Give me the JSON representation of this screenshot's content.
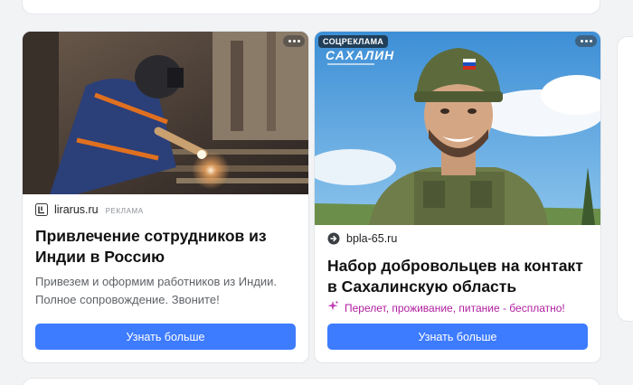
{
  "ads": [
    {
      "image_alt": "Welder working in a factory",
      "source_domain": "lirarus.ru",
      "ad_marker": "РЕКЛАМА",
      "title": "Привлечение сотрудников из Индии в Россию",
      "description": "Привезем и оформим работников из Индии. Полное сопровождение. Звоните!",
      "cta_label": "Узнать больше",
      "favicon_icon": "lirarus-logo-icon"
    },
    {
      "image_alt": "Illustrated smiling soldier in camouflage helmet",
      "image_label": "СОЦРЕКЛАМА",
      "image_brand": "САХАЛИН",
      "source_domain": "bpla-65.ru",
      "title": "Набор добровольцев на контакт в Сахалинскую область",
      "promo": "Перелет, проживание, питание - бесплатно!",
      "cta_label": "Узнать больше",
      "favicon_icon": "arrow-circle-icon",
      "promo_icon": "sparkle-icon"
    }
  ],
  "colors": {
    "cta_background": "#3d7bff",
    "promo_text": "#b01fa0",
    "page_background": "#f2f3f5"
  }
}
